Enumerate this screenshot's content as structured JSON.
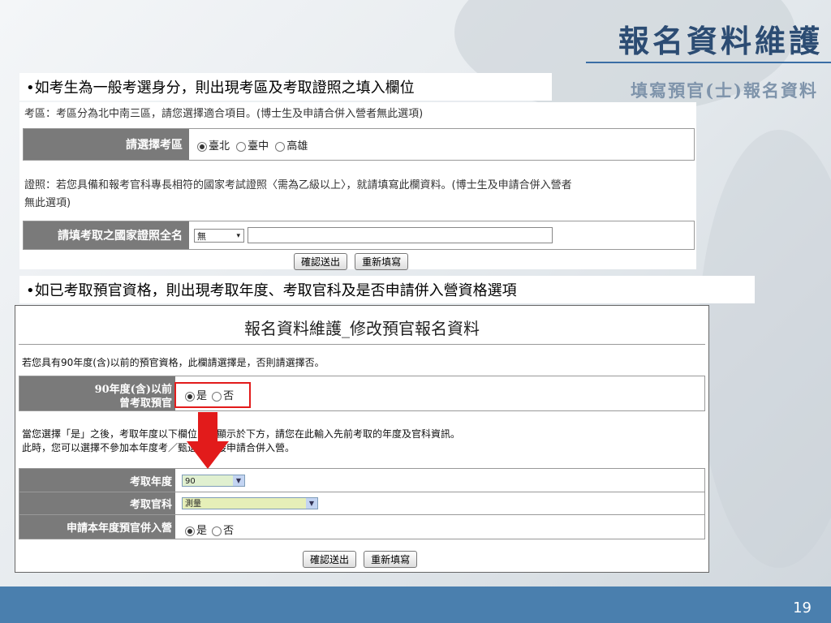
{
  "slide": {
    "title": "報名資料維護",
    "subtitle": "填寫預官(士)報名資料",
    "bullet1": "•如考生為一般考選身分，則出現考區及考取證照之填入欄位",
    "bullet2": "•如已考取預官資格，則出現考取年度、考取官科及是否申請併入營資格選項",
    "page_number": "19"
  },
  "panel1": {
    "area_note": "考區：考區分為北中南三區，請您選擇適合項目。(博士生及申請合併入營者無此選項)",
    "area_label": "請選擇考區",
    "area_options": [
      {
        "label": "臺北",
        "selected": true
      },
      {
        "label": "臺中",
        "selected": false
      },
      {
        "label": "高雄",
        "selected": false
      }
    ],
    "cert_note_1": "證照：若您具備和報考官科專長相符的國家考試證照〈需為乙級以上〉，就請填寫此欄資料。(博士生及申請合併入營者",
    "cert_note_2": "無此選項)",
    "cert_label": "請填考取之國家證照全名",
    "cert_select_value": "無",
    "cert_input_value": "",
    "submit_label": "確認送出",
    "reset_label": "重新填寫"
  },
  "panel2": {
    "title": "報名資料維護_修改預官報名資料",
    "note1": "若您具有90年度(含)以前的預官資格，此欄請選擇是，否則請選擇否。",
    "q_label_1": "90年度(含)以前",
    "q_label_2": "曾考取預官",
    "q_options": [
      {
        "label": "是",
        "selected": true
      },
      {
        "label": "否",
        "selected": false
      }
    ],
    "note2": "當您選擇「是」之後，考取年度以下欄位即會顯示於下方，請您在此輸入先前考取的年度及官科資訊。",
    "note3": "此時，您可以選擇不參加本年度考／甄選，直接申請合併入營。",
    "year_label": "考取年度",
    "year_value": "90",
    "branch_label": "考取官科",
    "branch_value": "測量",
    "merge_label": "申請本年度預官併入營",
    "merge_options": [
      {
        "label": "是",
        "selected": true
      },
      {
        "label": "否",
        "selected": false
      }
    ],
    "submit_label": "確認送出",
    "reset_label": "重新填寫"
  },
  "colors": {
    "title": "#2c4c73",
    "footer": "#4a7fae",
    "label_bg": "#7a7a7a",
    "highlight": "#e21b1b",
    "year_bg": "#e0f0d0",
    "branch_bg": "#e6efb8"
  }
}
